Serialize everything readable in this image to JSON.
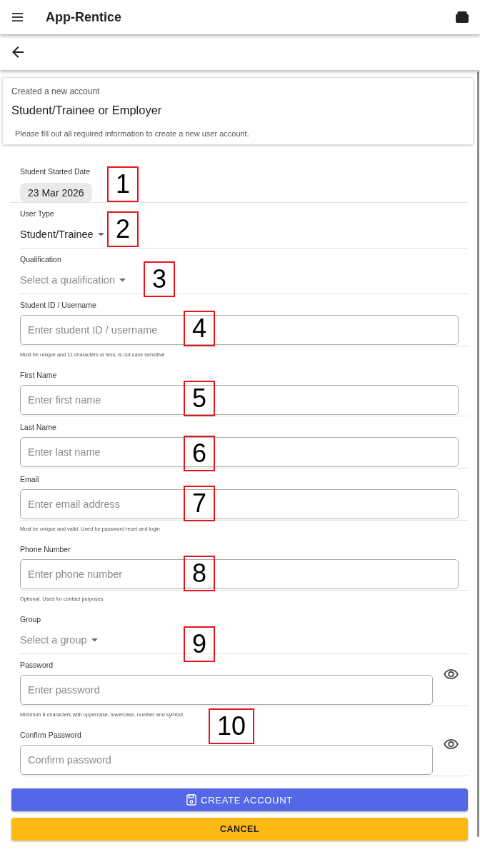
{
  "app_bar": {
    "title": "App-Rentice"
  },
  "header": {
    "subtitle": "Created a new account",
    "title": "Student/Trainee or Employer",
    "description": "Please fill out all required information to create a new user account."
  },
  "fields": [
    {
      "kind": "date",
      "label": "Student Started Date",
      "value": "23 Mar 2026",
      "callout": "1"
    },
    {
      "kind": "select",
      "label": "User Type",
      "value": "Student/Trainee",
      "callout": "2"
    },
    {
      "kind": "select",
      "label": "Qualification",
      "placeholder": "Select a qualification",
      "callout": "3"
    },
    {
      "kind": "text",
      "label": "Student ID / Username",
      "placeholder": "Enter student ID / username",
      "hint": "Must be unique and 11 characters or less, is not case sensitive",
      "callout": "4"
    },
    {
      "kind": "text",
      "label": "First Name",
      "placeholder": "Enter first name",
      "callout": "5"
    },
    {
      "kind": "text",
      "label": "Last Name",
      "placeholder": "Enter last name",
      "callout": "6"
    },
    {
      "kind": "text",
      "label": "Email",
      "placeholder": "Enter email address",
      "hint": "Must be unique and valid. Used for password reset and login",
      "callout": "7"
    },
    {
      "kind": "text",
      "label": "Phone Number",
      "placeholder": "Enter phone number",
      "hint": "Optional. Used for contact purposes",
      "callout": "8"
    },
    {
      "kind": "select",
      "label": "Group",
      "placeholder": "Select a group",
      "callout": "9"
    },
    {
      "kind": "password",
      "label": "Password",
      "placeholder": "Enter password",
      "hint": "Minimum 8 characters with uppercase, lowercase, number and symbol",
      "callout": "10"
    },
    {
      "kind": "password",
      "label": "Confirm Password",
      "placeholder": "Confirm password"
    }
  ],
  "buttons": [
    {
      "kind": "primary",
      "label": "CREATE ACCOUNT"
    },
    {
      "kind": "cancel",
      "label": "CANCEL"
    }
  ]
}
